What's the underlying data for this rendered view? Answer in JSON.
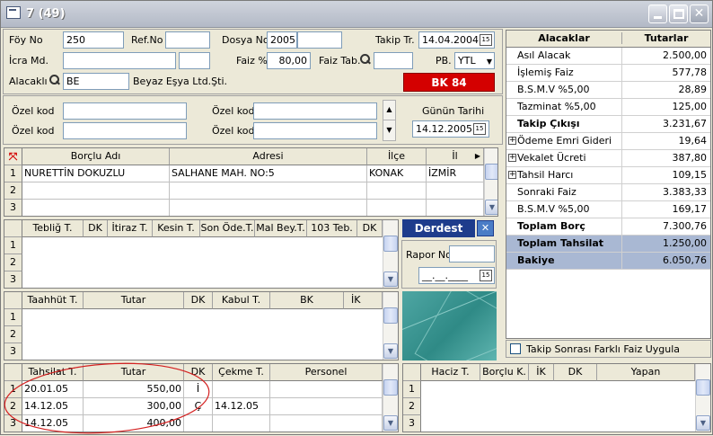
{
  "window": {
    "title": "7 (49)"
  },
  "form": {
    "foy_no_label": "Föy No",
    "foy_no": "250",
    "ref_no_label": "Ref.No",
    "ref_no": "",
    "dosya_no_label": "Dosya No",
    "dosya_no": "2005",
    "dosya_no2": "",
    "takip_tr_label": "Takip Tr.",
    "takip_tr": "14.04.2004",
    "icra_md_label": "İcra Md.",
    "icra_md": "",
    "icra_md2": "",
    "faiz_label": "Faiz %",
    "faiz": "80,00",
    "faiz_tab_label": "Faiz Tab.",
    "faiz_tab": "",
    "pb_label": "PB.",
    "pb": "YTL",
    "alacakli_label": "Alacaklı",
    "alacakli_code": "BE",
    "alacakli_name": "Beyaz Eşya Ltd.Şti.",
    "bk_badge": "BK 84",
    "ozel_kod_label": "Özel kod",
    "gunun_tarihi_label": "Günün Tarihi",
    "gunun_tarihi": "14.12.2005",
    "date_icon": "15"
  },
  "borclu_grid": {
    "headers": [
      "Borçlu Adı",
      "Adresi",
      "İlçe",
      "İl"
    ],
    "rows": [
      {
        "n": "1",
        "cells": [
          "NURETTİN DOKUZLU",
          "SALHANE MAH. NO:5",
          "KONAK",
          "İZMİR"
        ]
      },
      {
        "n": "2",
        "cells": [
          "",
          "",
          "",
          ""
        ]
      },
      {
        "n": "3",
        "cells": [
          "",
          "",
          "",
          ""
        ]
      }
    ]
  },
  "teblig_grid": {
    "headers": [
      "Tebliğ T.",
      "DK",
      "İtiraz T.",
      "Kesin T.",
      "Son Öde.T.",
      "Mal Bey.T.",
      "103 Teb.",
      "DK"
    ],
    "row_numbers": [
      "1",
      "2",
      "3"
    ]
  },
  "derdest": {
    "label": "Derdest",
    "rapor_no_label": "Rapor No",
    "rapor_no": "",
    "date_placeholder": "__.__.____"
  },
  "taahhut_grid": {
    "headers": [
      "Taahhüt T.",
      "Tutar",
      "DK",
      "Kabul T.",
      "BK",
      "İK"
    ],
    "row_numbers": [
      "1",
      "2",
      "3"
    ]
  },
  "tahsilat_grid": {
    "headers": [
      "Tahsilat T.",
      "Tutar",
      "DK",
      "Çekme T.",
      "Personel"
    ],
    "rows": [
      {
        "n": "1",
        "cells": [
          "20.01.05",
          "550,00",
          "İ",
          "",
          ""
        ]
      },
      {
        "n": "2",
        "cells": [
          "14.12.05",
          "300,00",
          "Ç",
          "14.12.05",
          ""
        ]
      },
      {
        "n": "3",
        "cells": [
          "14.12.05",
          "400,00",
          "",
          "",
          ""
        ]
      }
    ]
  },
  "haciz_grid": {
    "headers": [
      "Haciz T.",
      "Borçlu K.",
      "İK",
      "DK",
      "Yapan"
    ],
    "row_numbers": [
      "1",
      "2",
      "3"
    ]
  },
  "alacaklar": {
    "headers": [
      "Alacaklar",
      "Tutarlar"
    ],
    "rows": [
      {
        "label": "Asıl Alacak",
        "value": "2.500,00",
        "bold": false,
        "expand": false
      },
      {
        "label": "İşlemiş Faiz",
        "value": "577,78",
        "bold": false,
        "expand": false
      },
      {
        "label": "B.S.M.V %5,00",
        "value": "28,89",
        "bold": false,
        "expand": false
      },
      {
        "label": "Tazminat %5,00",
        "value": "125,00",
        "bold": false,
        "expand": false
      },
      {
        "label": "Takip Çıkışı",
        "value": "3.231,67",
        "bold": true,
        "expand": false
      },
      {
        "label": "Ödeme Emri Gideri",
        "value": "19,64",
        "bold": false,
        "expand": true
      },
      {
        "label": "Vekalet Ücreti",
        "value": "387,80",
        "bold": false,
        "expand": true
      },
      {
        "label": "Tahsil Harcı",
        "value": "109,15",
        "bold": false,
        "expand": true
      },
      {
        "label": "Sonraki Faiz",
        "value": "3.383,33",
        "bold": false,
        "expand": false
      },
      {
        "label": "B.S.M.V %5,00",
        "value": "169,17",
        "bold": false,
        "expand": false
      },
      {
        "label": "Toplam Borç",
        "value": "7.300,76",
        "bold": true,
        "expand": false
      },
      {
        "label": "Toplam Tahsilat",
        "value": "1.250,00",
        "bold": true,
        "expand": false
      },
      {
        "label": "Bakiye",
        "value": "6.050,76",
        "bold": true,
        "expand": false
      }
    ],
    "footer_checkbox": "Takip Sonrası Farklı Faiz Uygula"
  },
  "colors": {
    "accent_red": "#d40000",
    "highlight_row": "#a9b8d3",
    "derdest_bg": "#1e3c8c"
  }
}
